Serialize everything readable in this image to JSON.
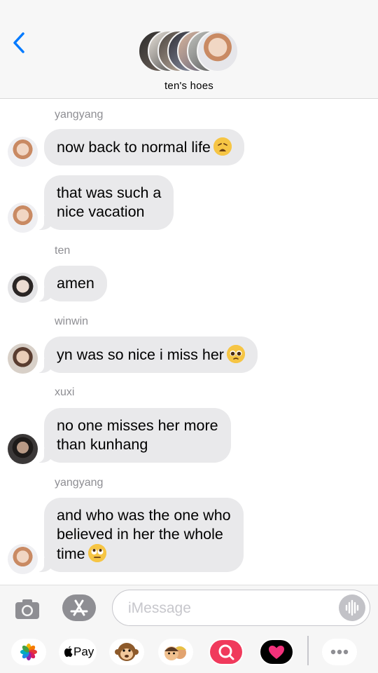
{
  "header": {
    "group_name": "ten's hoes"
  },
  "messages": [
    {
      "sender": "yangyang",
      "lines": [
        "now back to normal life"
      ],
      "emoji": "weary-face"
    },
    {
      "lines": [
        "that was such a",
        "nice vacation"
      ]
    },
    {
      "sender": "ten",
      "lines": [
        "amen"
      ]
    },
    {
      "sender": "winwin",
      "lines": [
        "yn was so nice i miss her"
      ],
      "emoji": "pleading-face"
    },
    {
      "sender": "xuxi",
      "lines": [
        "no one misses her more",
        "than kunhang"
      ]
    },
    {
      "sender": "yangyang",
      "lines": [
        "and who was the one who",
        "believed in her the whole",
        "time"
      ],
      "emoji": "eye-roll-face"
    }
  ],
  "input": {
    "placeholder": "iMessage"
  },
  "app_drawer": {
    "apple_pay_label": "Pay",
    "items": [
      "photos-icon",
      "apple-pay-icon",
      "monkey-icon",
      "memoji-icon",
      "image-search-icon",
      "digital-touch-icon",
      "more-icon"
    ]
  },
  "colors": {
    "accent": "#007aff",
    "bubble": "#e9e9eb",
    "meta_text": "#8e8e93"
  }
}
